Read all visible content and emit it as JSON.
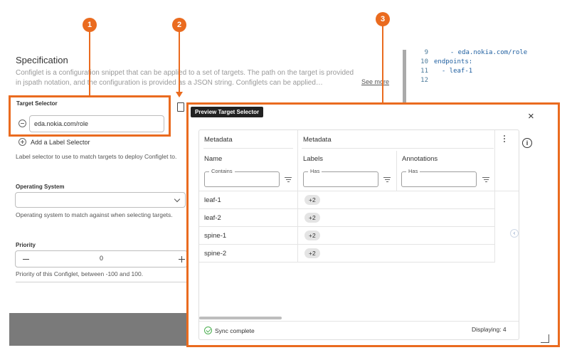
{
  "spec": {
    "title": "Specification",
    "description": "Configlet is a configuration snippet that can be applied to a set of targets. The path on the target is provided in jspath notation, and the configuration is provided as a JSON string. Configlets can be applied…",
    "see_more": "See more"
  },
  "target_selector": {
    "label": "Target Selector",
    "value": "eda.nokia.com/role",
    "add_label": "Add a Label Selector",
    "help": "Label selector to use to match targets to deploy Configlet to."
  },
  "operating_system": {
    "label": "Operating System",
    "value": "",
    "help": "Operating system to match against when selecting targets."
  },
  "priority": {
    "label": "Priority",
    "value": "0",
    "help": "Priority of this Configlet, between -100 and 100."
  },
  "code": {
    "lines": [
      {
        "num": "9",
        "text": "  - eda.nokia.com/role"
      },
      {
        "num": "10",
        "text": "endpoints:"
      },
      {
        "num": "11",
        "text": "  - leaf-1"
      },
      {
        "num": "12",
        "text": ""
      }
    ]
  },
  "callouts": [
    "1",
    "2",
    "3"
  ],
  "dialog": {
    "tooltip": "Preview Target Selector",
    "close": "×",
    "info": "i",
    "group_headers": [
      "Metadata",
      "Metadata"
    ],
    "columns": [
      "Name",
      "Labels",
      "Annotations"
    ],
    "filters": [
      {
        "label": "Contains",
        "value": ""
      },
      {
        "label": "Has",
        "value": ""
      },
      {
        "label": "Has",
        "value": ""
      }
    ],
    "rows": [
      {
        "name": "leaf-1",
        "labels": "+2"
      },
      {
        "name": "leaf-2",
        "labels": "+2"
      },
      {
        "name": "spine-1",
        "labels": "+2"
      },
      {
        "name": "spine-2",
        "labels": "+2"
      }
    ],
    "status": "Sync complete",
    "displaying": "Displaying: 4"
  },
  "colors": {
    "accent": "#ea6b1f",
    "success": "#4caf50"
  },
  "icons": [
    "minus-circle-icon",
    "plus-circle-icon",
    "chevron-down-icon",
    "preview-doc-icon",
    "close-icon",
    "info-icon",
    "kebab-icon",
    "filter-icon",
    "check-circle-icon",
    "collapse-icon"
  ]
}
